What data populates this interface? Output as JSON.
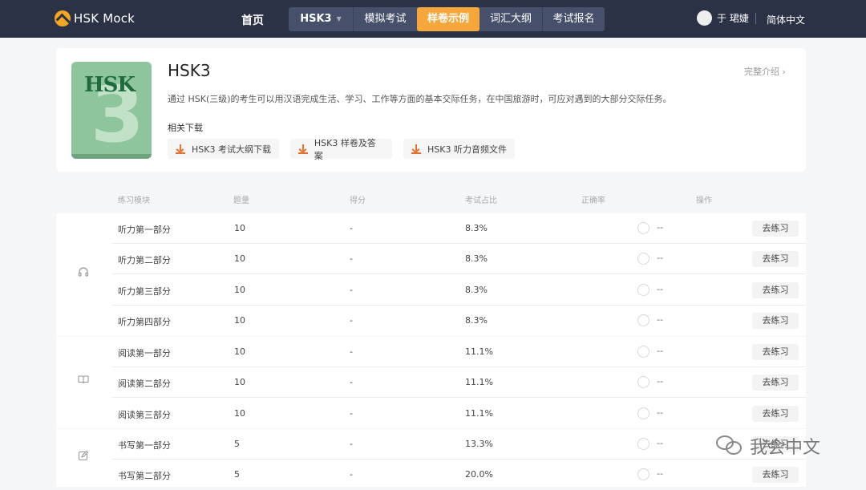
{
  "nav": {
    "logo_text": "HSK Mock",
    "home": "首页",
    "level": "HSK3",
    "tabs": [
      "模拟考试",
      "样卷示例",
      "词汇大纲",
      "考试报名"
    ],
    "active_tab": "样卷示例",
    "user_name": "于 珺婕",
    "language": "简体中文",
    "accent_color": "#f7a63c"
  },
  "intro": {
    "book_label": "HSK",
    "book_number": "3",
    "title": "HSK3",
    "more_link": "完整介绍",
    "description": "通过 HSK(三级)的考生可以用汉语完成生活、学习、工作等方面的基本交际任务，在中国旅游时，可应对遇到的大部分交际任务。",
    "downloads_title": "相关下载",
    "downloads": [
      {
        "label": "HSK3  考试大纲下载"
      },
      {
        "label": "HSK3  样卷及答案"
      },
      {
        "label": "HSK3  听力音频文件"
      }
    ]
  },
  "table": {
    "headers": {
      "module": "练习模块",
      "count": "题量",
      "score": "得分",
      "share": "考试占比",
      "accuracy": "正确率",
      "action": "操作"
    },
    "sections": [
      {
        "icon": "headphones-icon",
        "rows": [
          {
            "module": "听力第一部分",
            "count": "10",
            "score": "-",
            "share": "8.3%",
            "accuracy": "--",
            "action": "去练习"
          },
          {
            "module": "听力第二部分",
            "count": "10",
            "score": "-",
            "share": "8.3%",
            "accuracy": "--",
            "action": "去练习"
          },
          {
            "module": "听力第三部分",
            "count": "10",
            "score": "-",
            "share": "8.3%",
            "accuracy": "--",
            "action": "去练习"
          },
          {
            "module": "听力第四部分",
            "count": "10",
            "score": "-",
            "share": "8.3%",
            "accuracy": "--",
            "action": "去练习"
          }
        ]
      },
      {
        "icon": "book-icon",
        "rows": [
          {
            "module": "阅读第一部分",
            "count": "10",
            "score": "-",
            "share": "11.1%",
            "accuracy": "--",
            "action": "去练习"
          },
          {
            "module": "阅读第二部分",
            "count": "10",
            "score": "-",
            "share": "11.1%",
            "accuracy": "--",
            "action": "去练习"
          },
          {
            "module": "阅读第三部分",
            "count": "10",
            "score": "-",
            "share": "11.1%",
            "accuracy": "--",
            "action": "去练习"
          }
        ]
      },
      {
        "icon": "edit-icon",
        "rows": [
          {
            "module": "书写第一部分",
            "count": "5",
            "score": "-",
            "share": "13.3%",
            "accuracy": "--",
            "action": "去练习"
          },
          {
            "module": "书写第二部分",
            "count": "5",
            "score": "-",
            "share": "20.0%",
            "accuracy": "--",
            "action": "去练习"
          }
        ]
      }
    ]
  },
  "watermark": {
    "text": "我会中文"
  }
}
